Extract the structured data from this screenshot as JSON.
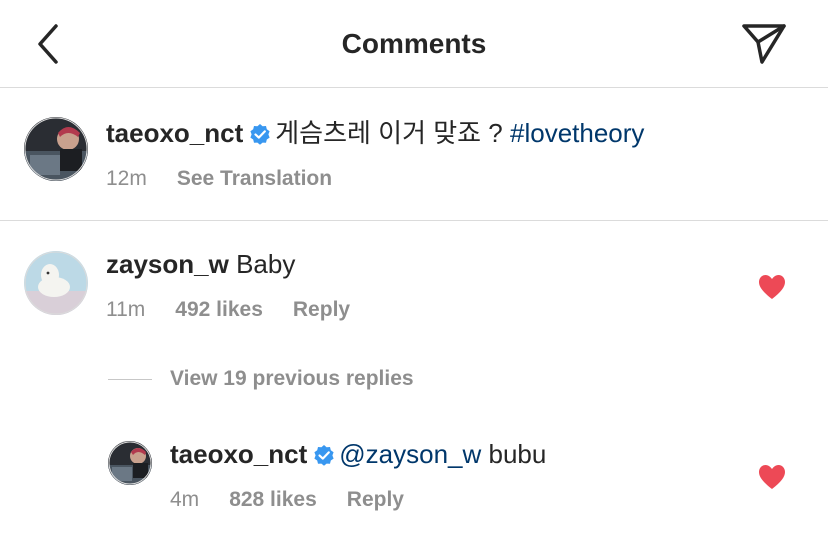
{
  "header": {
    "title": "Comments",
    "back_icon": "chevron-left-icon",
    "share_icon": "paper-plane-icon"
  },
  "caption": {
    "username": "taeoxo_nct",
    "verified": true,
    "text": "게슴츠레 이거 맞죠 ?",
    "hashtag": "#lovetheory",
    "time": "12m",
    "see_translation": "See Translation"
  },
  "comment": {
    "username": "zayson_w",
    "text": "Baby",
    "time": "11m",
    "likes": "492 likes",
    "reply": "Reply",
    "liked": true
  },
  "view_replies": "View 19 previous replies",
  "reply": {
    "username": "taeoxo_nct",
    "verified": true,
    "mention": "@zayson_w",
    "text": "bubu",
    "time": "4m",
    "likes": "828 likes",
    "reply": "Reply",
    "liked": true
  },
  "colors": {
    "text": "#262626",
    "secondary": "#8e8e8e",
    "link": "#00376b",
    "verified": "#3897f0",
    "heart": "#ed4956",
    "divider": "#dbdbdb"
  }
}
